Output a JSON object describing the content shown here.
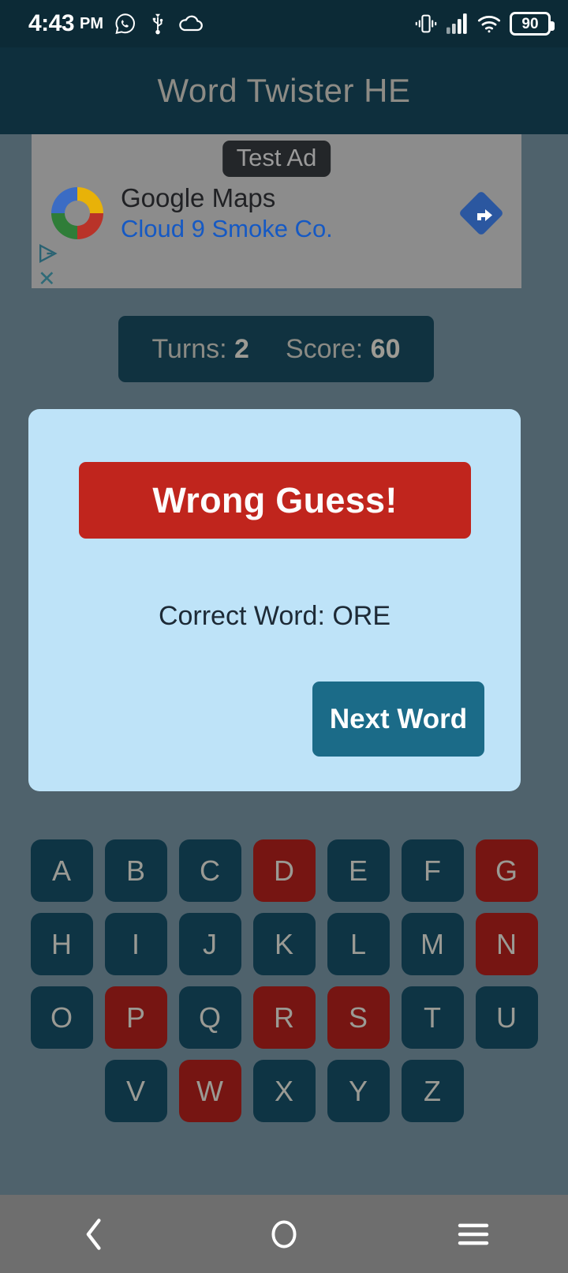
{
  "status_bar": {
    "time": "4:43",
    "ampm": "PM",
    "icons": [
      "whatsapp-icon",
      "usb-icon",
      "cloud-icon"
    ],
    "right_icons": [
      "vibrate-icon",
      "signal-icon",
      "wifi-icon"
    ],
    "battery_percent": "90"
  },
  "app_bar": {
    "title": "Word Twister HE"
  },
  "ad": {
    "label": "Test Ad",
    "advertiser": "Google Maps",
    "headline": "Cloud 9 Smoke Co.",
    "logo_icon": "google-ring-icon",
    "action_icon": "maps-navigation-diamond-icon",
    "adchoices_icon": "adchoices-icon",
    "close_icon": "close-icon"
  },
  "score_bar": {
    "turns_label": "Turns:",
    "turns_value": "2",
    "score_label": "Score:",
    "score_value": "60"
  },
  "dialog": {
    "banner_text": "Wrong Guess!",
    "correct_word_text": "Correct Word: ORE",
    "next_button_label": "Next Word"
  },
  "keyboard": {
    "rows": [
      [
        {
          "letter": "A",
          "used": false
        },
        {
          "letter": "B",
          "used": false
        },
        {
          "letter": "C",
          "used": false
        },
        {
          "letter": "D",
          "used": true
        },
        {
          "letter": "E",
          "used": false
        },
        {
          "letter": "F",
          "used": false
        },
        {
          "letter": "G",
          "used": true
        }
      ],
      [
        {
          "letter": "H",
          "used": false
        },
        {
          "letter": "I",
          "used": false
        },
        {
          "letter": "J",
          "used": false
        },
        {
          "letter": "K",
          "used": false
        },
        {
          "letter": "L",
          "used": false
        },
        {
          "letter": "M",
          "used": false
        },
        {
          "letter": "N",
          "used": true
        }
      ],
      [
        {
          "letter": "O",
          "used": false
        },
        {
          "letter": "P",
          "used": true
        },
        {
          "letter": "Q",
          "used": false
        },
        {
          "letter": "R",
          "used": true
        },
        {
          "letter": "S",
          "used": true
        },
        {
          "letter": "T",
          "used": false
        },
        {
          "letter": "U",
          "used": false
        }
      ],
      [
        {
          "letter": "V",
          "used": false
        },
        {
          "letter": "W",
          "used": true
        },
        {
          "letter": "X",
          "used": false
        },
        {
          "letter": "Y",
          "used": false
        },
        {
          "letter": "Z",
          "used": false
        }
      ]
    ]
  },
  "nav_bar": {
    "back_icon": "back-chevron-icon",
    "home_icon": "home-circle-icon",
    "recents_icon": "menu-lines-icon"
  },
  "colors": {
    "status_bar_bg": "#0c2a36",
    "app_bar_bg": "#0e2f3d",
    "page_bg": "#4f626c",
    "dialog_bg": "#bee3f8",
    "banner_red": "#c0251d",
    "accent_teal": "#1b6b88",
    "key_available": "#0e3444",
    "key_used": "#761512",
    "nav_bar_bg": "#6e6e6e"
  }
}
